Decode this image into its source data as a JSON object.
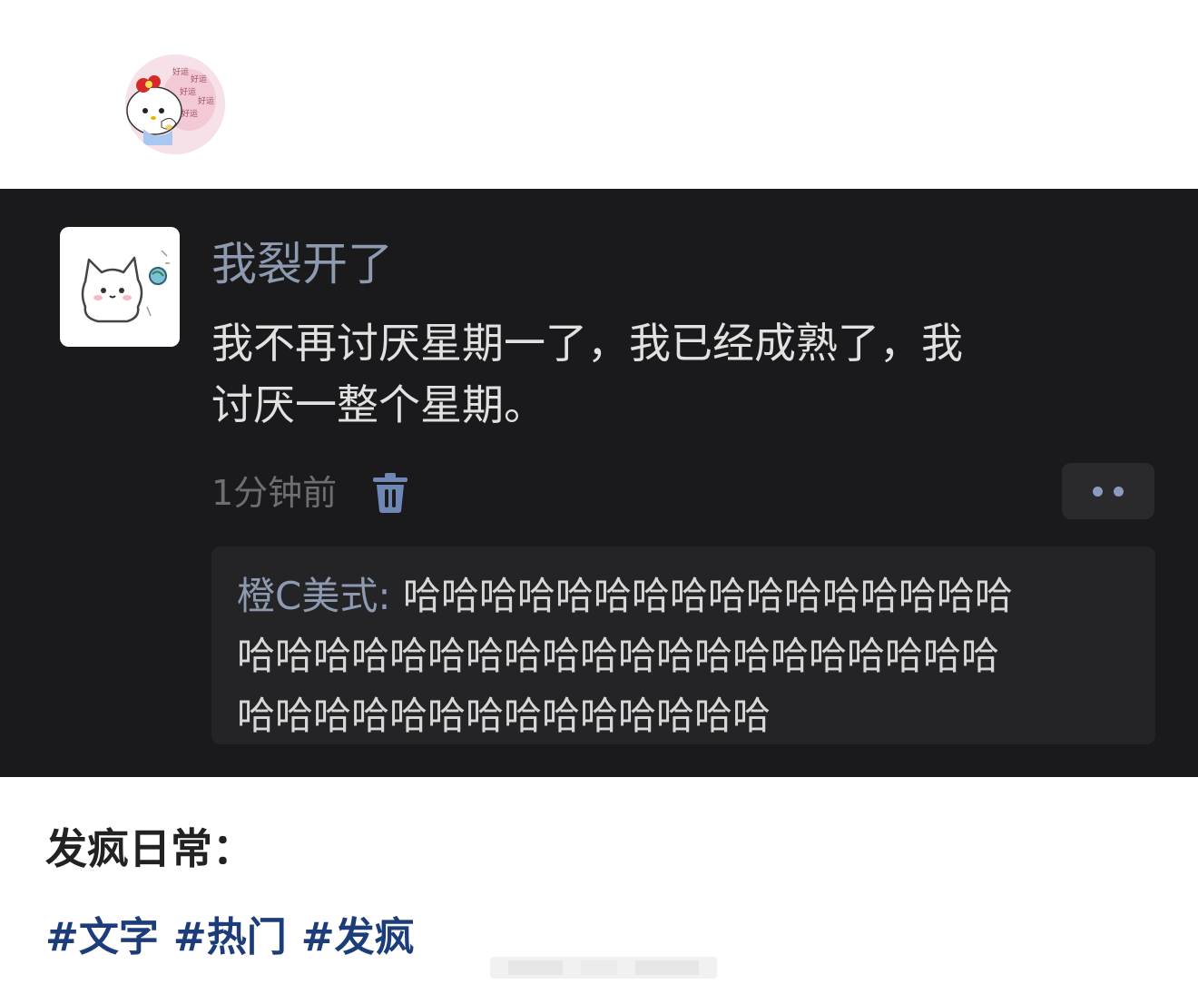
{
  "post": {
    "caption": "发疯日常：",
    "tags": [
      "#文字",
      "#热门",
      "#发疯"
    ]
  },
  "comment": {
    "username": "我裂开了",
    "text": "我不再讨厌星期一了，我已经成熟了，我\n讨厌一整个星期。",
    "time": "1分钟前",
    "reply": {
      "author": "橙C美式:",
      "text": " 哈哈哈哈哈哈哈哈哈哈哈哈哈哈哈哈\n哈哈哈哈哈哈哈哈哈哈哈哈哈哈哈哈哈哈哈哈\n哈哈哈哈哈哈哈哈哈哈哈哈哈哈"
    }
  },
  "colors": {
    "dark_background": "#1a1a1c",
    "username": "#8d9ab0",
    "tag": "#1c3d7a"
  },
  "icons": {
    "top_avatar": "hello-kitty-avatar",
    "comment_avatar": "white-cat-avatar",
    "delete": "trash-icon",
    "more": "more-dots-icon"
  }
}
